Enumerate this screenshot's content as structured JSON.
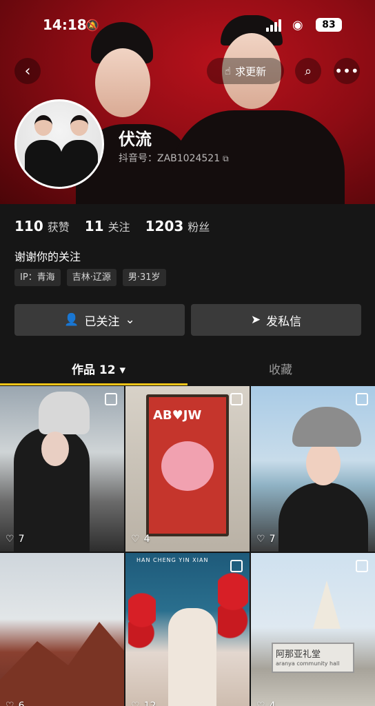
{
  "status_bar": {
    "time": "14:18",
    "battery": "83"
  },
  "header": {
    "update_label": "求更新",
    "username": "伏流",
    "douyin_id": "抖音号：ZAB1024521"
  },
  "stats": [
    {
      "num": "110",
      "label": "获赞"
    },
    {
      "num": "11",
      "label": "关注"
    },
    {
      "num": "1203",
      "label": "粉丝"
    }
  ],
  "bio": "谢谢你的关注",
  "tags": [
    "IP：青海",
    "吉林·辽源",
    "男·31岁"
  ],
  "actions": {
    "follow_label": "已关注",
    "message_label": "发私信"
  },
  "tabs": {
    "works_label": "作品 12",
    "favorites_label": "收藏"
  },
  "grid": {
    "items": [
      {
        "likes": "7"
      },
      {
        "likes": "4",
        "text": "AB♥JW"
      },
      {
        "likes": "7"
      },
      {
        "likes": "6"
      },
      {
        "likes": "12",
        "text": "HAN CHENG YIN XIAN"
      },
      {
        "likes": "4",
        "text": "阿那亚礼堂",
        "subtext": "aranya community hall"
      }
    ]
  },
  "colors": {
    "banner_red": "#8e0c14",
    "tab_underline": "#f5c518",
    "panel_bg": "#161616"
  }
}
